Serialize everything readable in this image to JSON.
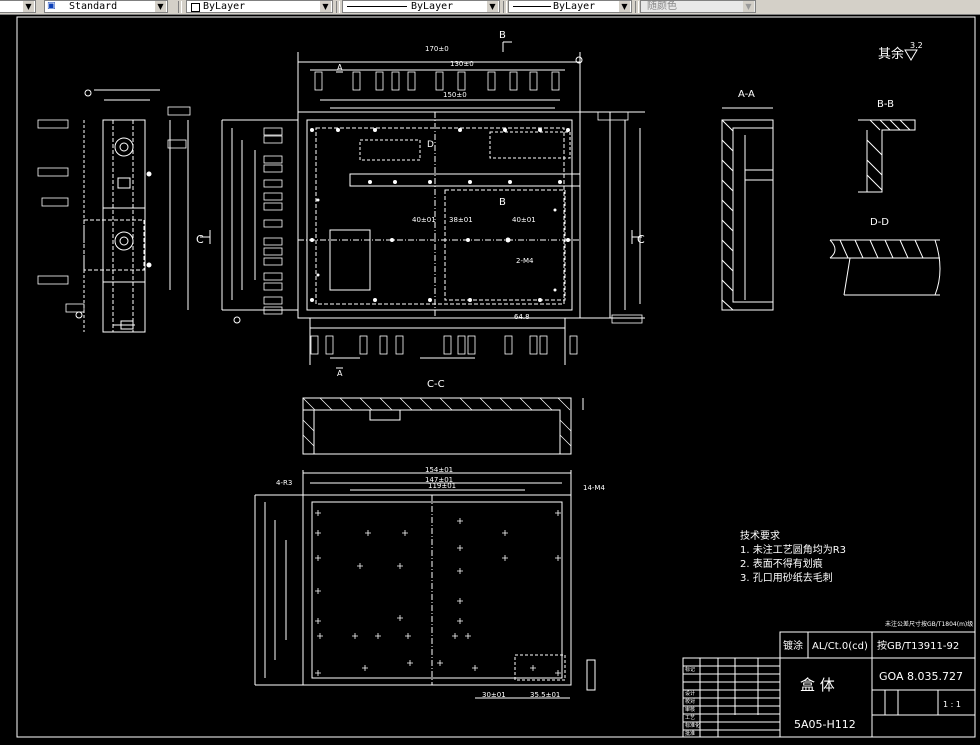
{
  "toolbar": {
    "text_style": "Standard",
    "layer": "ByLayer",
    "linetype": "ByLayer",
    "lineweight": "ByLayer",
    "color": "随颜色"
  },
  "drawing": {
    "roughness": "其余",
    "roughness_value": "3.2",
    "section_labels": {
      "aa": "A-A",
      "bb": "B-B",
      "cc": "C-C",
      "dd": "D-D",
      "b_top": "B",
      "b_bottom": "B",
      "c_left": "C",
      "c_right": "C",
      "a_top": "A",
      "a_bottom": "A",
      "d_label": "D"
    },
    "dims": [
      "170±0",
      "130±0",
      "150±0",
      "40±01",
      "38±01",
      "40±01",
      "64.8",
      "154±01",
      "147±01",
      "119±01",
      "4-R3",
      "14-M4",
      "2-M4",
      "30±01",
      "35.5±01"
    ],
    "tech_requirements": {
      "title": "技术要求",
      "items": [
        "1. 未注工艺圆角均为R3",
        "2. 表面不得有划痕",
        "3. 孔口用砂纸去毛刺"
      ]
    },
    "title_block": {
      "coating_label": "镀涂",
      "coating_value": "AL/Ct.0(cd)",
      "standard": "按GB/T13911-92",
      "note": "未注公差尺寸按GB/T1804(m)级",
      "part_name": "盒 体",
      "drawing_no": "GOA  8.035.727",
      "model": "5A05-H112",
      "scale": "1 : 1",
      "row_labels": [
        "标记",
        "设计",
        "校对",
        "审核",
        "工艺",
        "标准化",
        "批准"
      ]
    }
  }
}
